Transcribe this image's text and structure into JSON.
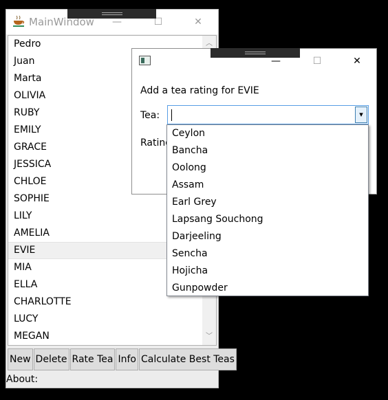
{
  "main_window": {
    "title": "MainWindow",
    "minimize": "—",
    "maximize": "☐",
    "close": "✕",
    "names": [
      "Pedro",
      "Juan",
      "Marta",
      "OLIVIA",
      "RUBY",
      "EMILY",
      "GRACE",
      "JESSICA",
      "CHLOE",
      "SOPHIE",
      "LILY",
      "AMELIA",
      "EVIE",
      "MIA",
      "ELLA",
      "CHARLOTTE",
      "LUCY",
      "MEGAN"
    ],
    "selected_name": "EVIE",
    "buttons": {
      "new": "New",
      "delete": "Delete",
      "rate": "Rate Tea",
      "info": "Info",
      "calc": "Calculate Best Teas"
    },
    "about": "About:"
  },
  "dialog": {
    "minimize": "—",
    "maximize": "☐",
    "close": "✕",
    "prompt": "Add a tea rating for EVIE",
    "tea_label": "Tea:",
    "rating_label": "Rating",
    "tea_value": "",
    "dropdown_arrow": "▾",
    "tea_options": [
      "Ceylon",
      "Bancha",
      "Oolong",
      "Assam",
      "Earl Grey",
      "Lapsang Souchong",
      "Darjeeling",
      "Sencha",
      "Hojicha",
      "Gunpowder"
    ]
  },
  "icons": {
    "app": "tea-cup-icon",
    "dialog": "window-icon",
    "scroll_up": "chevron-up-icon",
    "scroll_down": "chevron-down-icon"
  }
}
